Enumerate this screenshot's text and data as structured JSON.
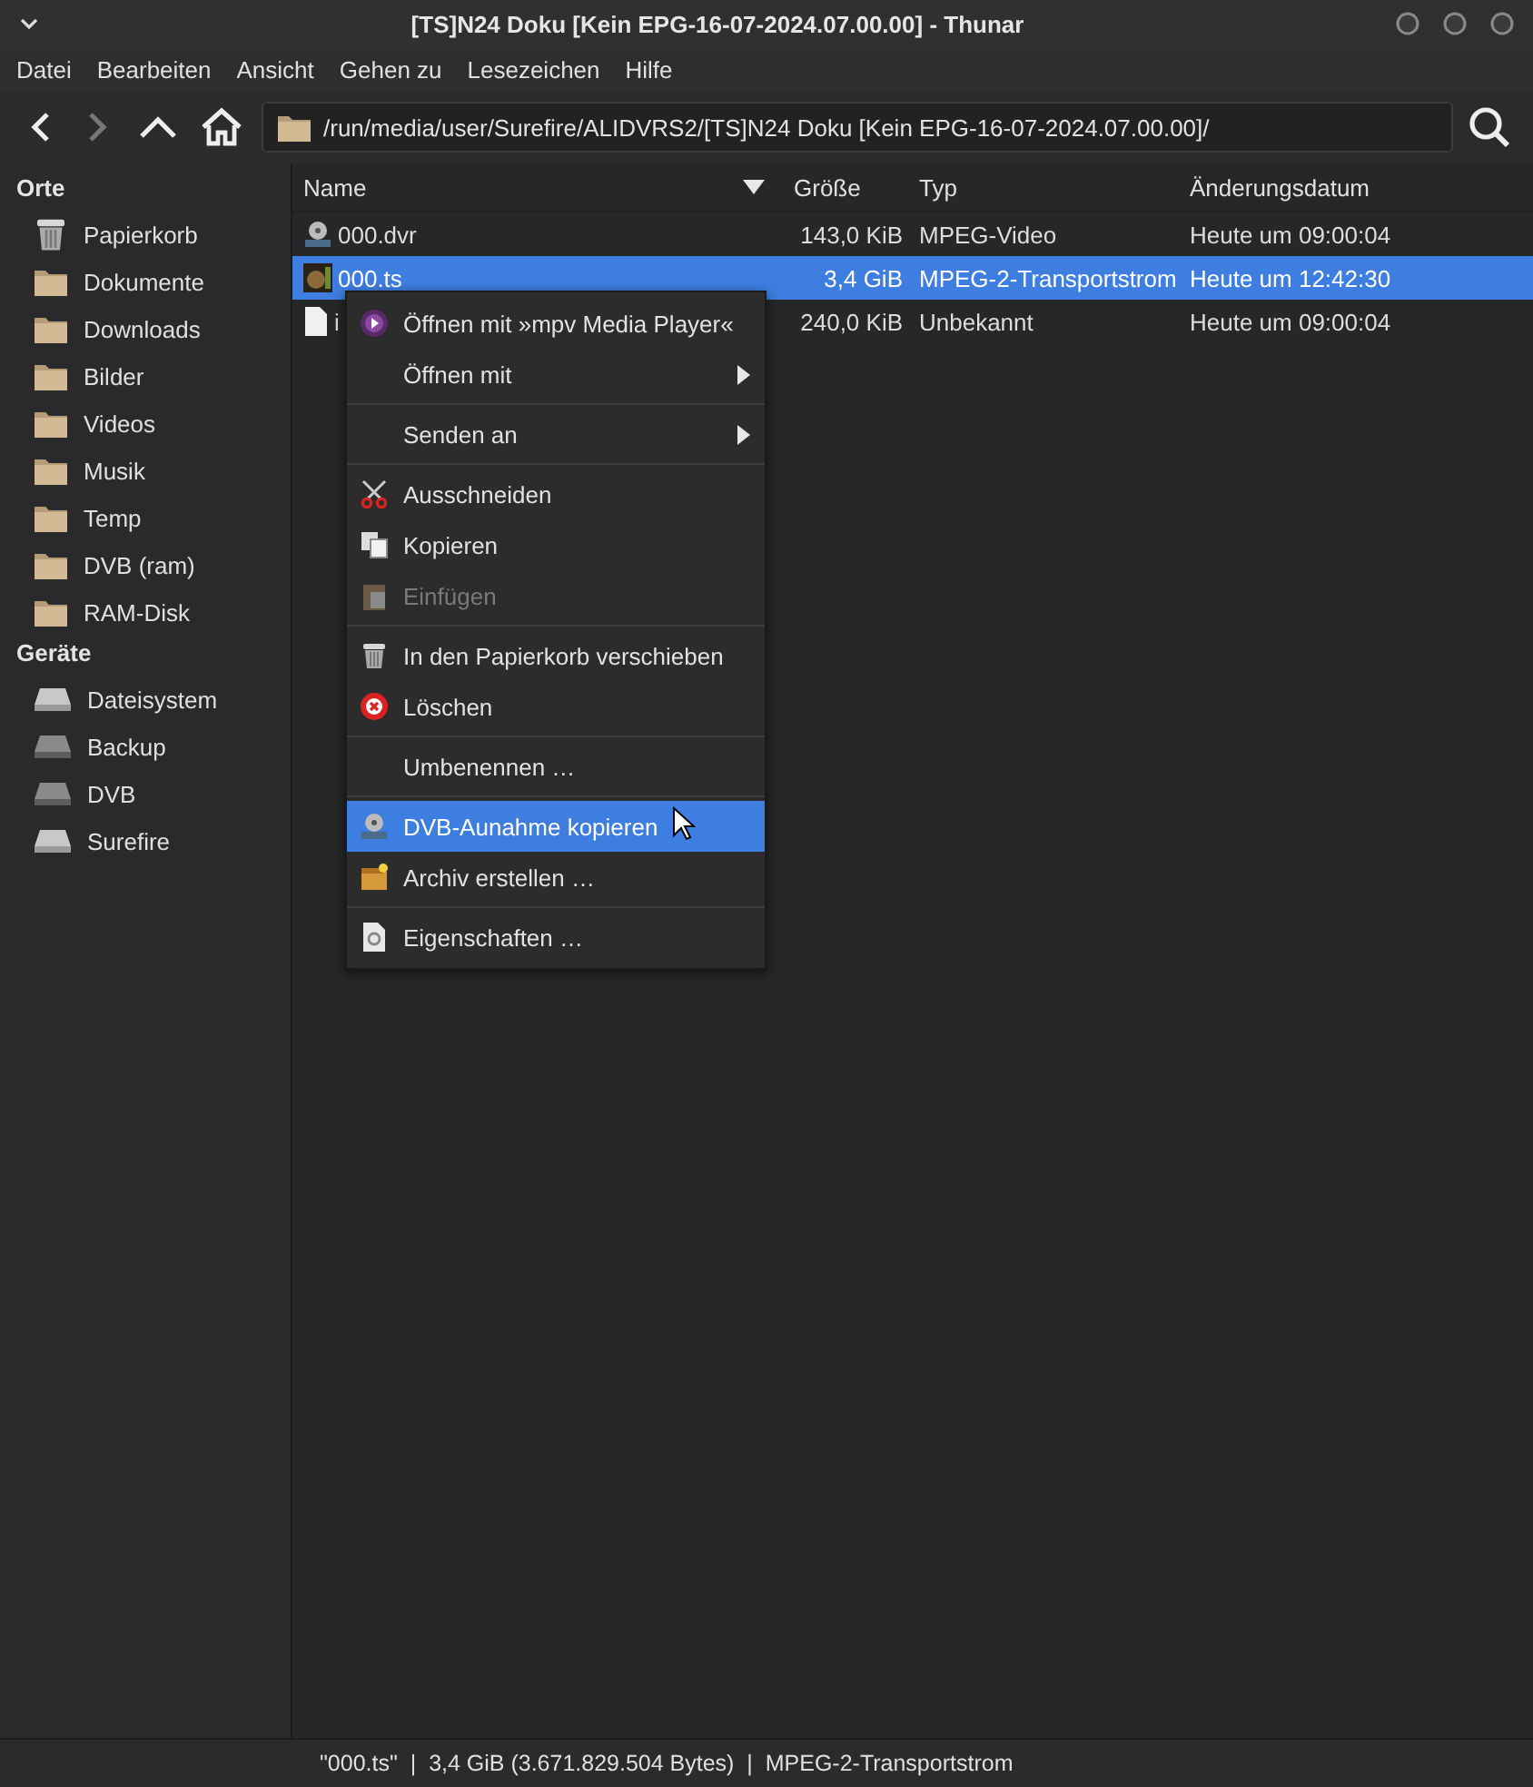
{
  "window": {
    "title": "[TS]N24 Doku [Kein EPG-16-07-2024.07.00.00] - Thunar"
  },
  "menu_bar": [
    "Datei",
    "Bearbeiten",
    "Ansicht",
    "Gehen zu",
    "Lesezeichen",
    "Hilfe"
  ],
  "toolbar": {
    "path": "/run/media/user/Surefire/ALIDVRS2/[TS]N24 Doku [Kein EPG-16-07-2024.07.00.00]/",
    "forward_disabled": true
  },
  "sidebar": {
    "sections": [
      {
        "title": "Orte",
        "kind": "places",
        "items": [
          {
            "label": "Papierkorb"
          },
          {
            "label": "Dokumente"
          },
          {
            "label": "Downloads"
          },
          {
            "label": "Bilder"
          },
          {
            "label": "Videos"
          },
          {
            "label": "Musik"
          },
          {
            "label": "Temp"
          },
          {
            "label": "DVB (ram)"
          },
          {
            "label": "RAM-Disk"
          }
        ]
      },
      {
        "title": "Geräte",
        "kind": "devices",
        "items": [
          {
            "label": "Dateisystem"
          },
          {
            "label": "Backup"
          },
          {
            "label": "DVB"
          },
          {
            "label": "Surefire"
          }
        ]
      }
    ]
  },
  "table": {
    "columns": [
      "Name",
      "Größe",
      "Typ",
      "Änderungsdatum"
    ],
    "rows": [
      {
        "name": "000.dvr",
        "size": "143,0 KiB",
        "type": "MPEG-Video",
        "modified": "Heute um 09:00:04",
        "selected": false
      },
      {
        "name": "000.ts",
        "size": "3,4 GiB",
        "type": "MPEG-2-Transportstrom",
        "modified": "Heute um 12:42:30",
        "selected": true
      },
      {
        "name": "i",
        "size": "240,0 KiB",
        "type": "Unbekannt",
        "modified": "Heute um 09:00:04",
        "selected": false
      }
    ]
  },
  "context_menu": [
    {
      "kind": "item",
      "label": "Öffnen mit »mpv Media Player«",
      "submenu": false,
      "disabled": false,
      "selected": false
    },
    {
      "kind": "item",
      "label": "Öffnen mit",
      "submenu": true,
      "disabled": false,
      "selected": false
    },
    {
      "kind": "separator"
    },
    {
      "kind": "item",
      "label": "Senden an",
      "submenu": true,
      "disabled": false,
      "selected": false
    },
    {
      "kind": "separator"
    },
    {
      "kind": "item",
      "label": "Ausschneiden",
      "submenu": false,
      "disabled": false,
      "selected": false
    },
    {
      "kind": "item",
      "label": "Kopieren",
      "submenu": false,
      "disabled": false,
      "selected": false
    },
    {
      "kind": "item",
      "label": "Einfügen",
      "submenu": false,
      "disabled": true,
      "selected": false
    },
    {
      "kind": "separator"
    },
    {
      "kind": "item",
      "label": "In den Papierkorb verschieben",
      "submenu": false,
      "disabled": false,
      "selected": false
    },
    {
      "kind": "item",
      "label": "Löschen",
      "submenu": false,
      "disabled": false,
      "selected": false
    },
    {
      "kind": "separator"
    },
    {
      "kind": "item",
      "label": "Umbenennen …",
      "submenu": false,
      "disabled": false,
      "selected": false
    },
    {
      "kind": "separator"
    },
    {
      "kind": "item",
      "label": "DVB-Aunahme kopieren",
      "submenu": false,
      "disabled": false,
      "selected": true
    },
    {
      "kind": "item",
      "label": "Archiv erstellen …",
      "submenu": false,
      "disabled": false,
      "selected": false
    },
    {
      "kind": "separator"
    },
    {
      "kind": "item",
      "label": "Eigenschaften …",
      "submenu": false,
      "disabled": false,
      "selected": false
    }
  ],
  "status_bar": "\"000.ts\"  |  3,4 GiB (3.671.829.504 Bytes)  |  MPEG-2-Transportstrom"
}
